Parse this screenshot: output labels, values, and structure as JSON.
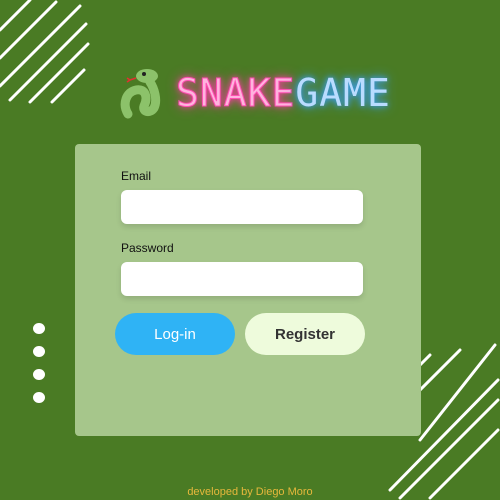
{
  "app": {
    "title_part1": "SNAKE",
    "title_part2": "GAME",
    "icon": "snake-icon"
  },
  "form": {
    "email_label": "Email",
    "email_value": "",
    "password_label": "Password",
    "password_value": "",
    "login_label": "Log-in",
    "register_label": "Register"
  },
  "footer": {
    "credit": "developed by Diego Moro"
  },
  "colors": {
    "background": "#4a7b24",
    "card": "#a6c68b",
    "login_button": "#2fb3f5",
    "register_button": "#eefbdc",
    "title_snake": "#ff3aa8",
    "title_game": "#3aa0ff",
    "footer_text": "#e7b83c"
  }
}
